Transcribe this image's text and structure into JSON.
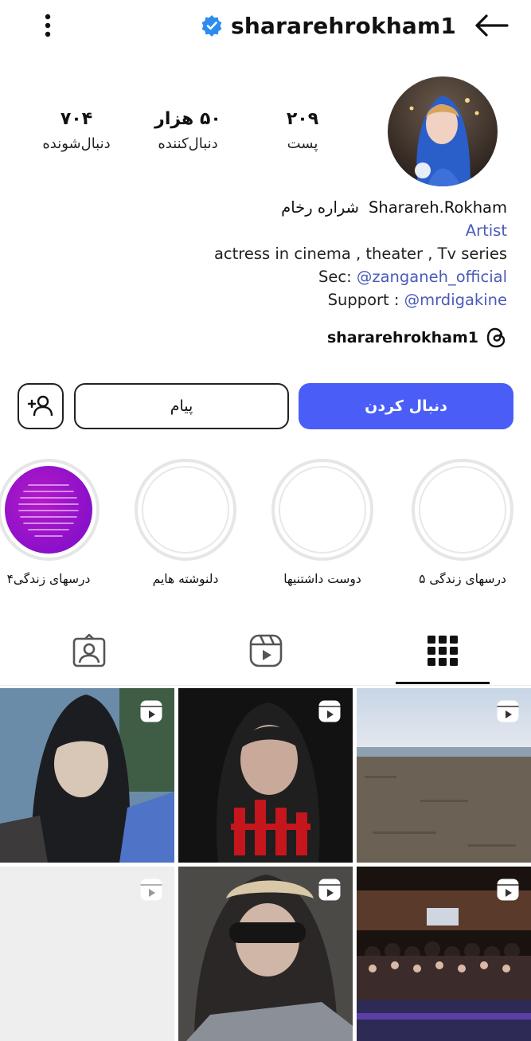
{
  "header": {
    "username": "shararehrokham1",
    "verified_icon": "verified-badge-icon",
    "menu_icon": "kebab-menu-icon",
    "back_icon": "arrow-left-icon"
  },
  "stats": {
    "posts": {
      "value": "۲۰۹",
      "label": "پست"
    },
    "followers": {
      "value": "۵۰ هزار",
      "label": "دنبال‌کننده"
    },
    "following": {
      "value": "۷۰۴",
      "label": "دنبال‌شونده"
    }
  },
  "bio": {
    "name_en": "Sharareh.Rokham",
    "name_fa": "شراره رخام",
    "category": "Artist",
    "line1": "actress in cinema , theater , Tv series",
    "sec_prefix": "Sec: ",
    "sec_handle": "@zanganeh_official",
    "support_prefix": "Support : ",
    "support_handle": "@mrdigakine",
    "threads_handle": "shararehrokham1"
  },
  "actions": {
    "follow_label": "دنبال کردن",
    "message_label": "پیام"
  },
  "highlights": [
    {
      "label": "درسهای زندگی ۵"
    },
    {
      "label": "دوست داشتنیها"
    },
    {
      "label": "دلنوشته هایم"
    },
    {
      "label": "درسهای زندگی۴"
    }
  ],
  "tabs": [
    "grid-icon",
    "reels-icon",
    "tagged-icon"
  ],
  "colors": {
    "accent": "#4a5ef7",
    "link": "#4a5bb8",
    "verified": "#2d8cf0",
    "highlight_purple": "#9b14c8"
  }
}
